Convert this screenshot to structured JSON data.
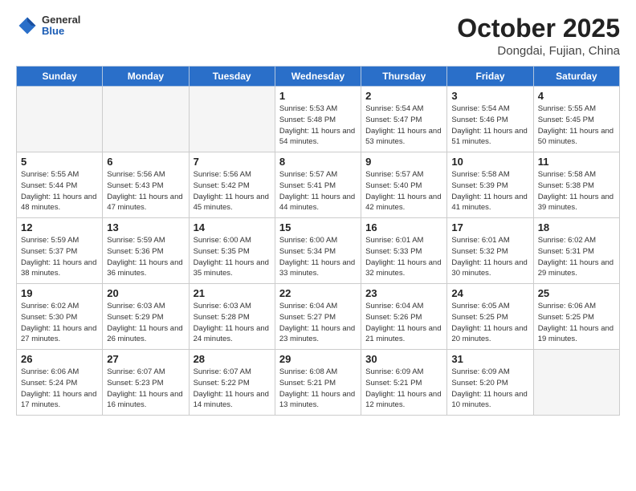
{
  "header": {
    "logo_general": "General",
    "logo_blue": "Blue",
    "month": "October 2025",
    "location": "Dongdai, Fujian, China"
  },
  "weekdays": [
    "Sunday",
    "Monday",
    "Tuesday",
    "Wednesday",
    "Thursday",
    "Friday",
    "Saturday"
  ],
  "weeks": [
    [
      {
        "day": "",
        "info": ""
      },
      {
        "day": "",
        "info": ""
      },
      {
        "day": "",
        "info": ""
      },
      {
        "day": "1",
        "info": "Sunrise: 5:53 AM\nSunset: 5:48 PM\nDaylight: 11 hours\nand 54 minutes."
      },
      {
        "day": "2",
        "info": "Sunrise: 5:54 AM\nSunset: 5:47 PM\nDaylight: 11 hours\nand 53 minutes."
      },
      {
        "day": "3",
        "info": "Sunrise: 5:54 AM\nSunset: 5:46 PM\nDaylight: 11 hours\nand 51 minutes."
      },
      {
        "day": "4",
        "info": "Sunrise: 5:55 AM\nSunset: 5:45 PM\nDaylight: 11 hours\nand 50 minutes."
      }
    ],
    [
      {
        "day": "5",
        "info": "Sunrise: 5:55 AM\nSunset: 5:44 PM\nDaylight: 11 hours\nand 48 minutes."
      },
      {
        "day": "6",
        "info": "Sunrise: 5:56 AM\nSunset: 5:43 PM\nDaylight: 11 hours\nand 47 minutes."
      },
      {
        "day": "7",
        "info": "Sunrise: 5:56 AM\nSunset: 5:42 PM\nDaylight: 11 hours\nand 45 minutes."
      },
      {
        "day": "8",
        "info": "Sunrise: 5:57 AM\nSunset: 5:41 PM\nDaylight: 11 hours\nand 44 minutes."
      },
      {
        "day": "9",
        "info": "Sunrise: 5:57 AM\nSunset: 5:40 PM\nDaylight: 11 hours\nand 42 minutes."
      },
      {
        "day": "10",
        "info": "Sunrise: 5:58 AM\nSunset: 5:39 PM\nDaylight: 11 hours\nand 41 minutes."
      },
      {
        "day": "11",
        "info": "Sunrise: 5:58 AM\nSunset: 5:38 PM\nDaylight: 11 hours\nand 39 minutes."
      }
    ],
    [
      {
        "day": "12",
        "info": "Sunrise: 5:59 AM\nSunset: 5:37 PM\nDaylight: 11 hours\nand 38 minutes."
      },
      {
        "day": "13",
        "info": "Sunrise: 5:59 AM\nSunset: 5:36 PM\nDaylight: 11 hours\nand 36 minutes."
      },
      {
        "day": "14",
        "info": "Sunrise: 6:00 AM\nSunset: 5:35 PM\nDaylight: 11 hours\nand 35 minutes."
      },
      {
        "day": "15",
        "info": "Sunrise: 6:00 AM\nSunset: 5:34 PM\nDaylight: 11 hours\nand 33 minutes."
      },
      {
        "day": "16",
        "info": "Sunrise: 6:01 AM\nSunset: 5:33 PM\nDaylight: 11 hours\nand 32 minutes."
      },
      {
        "day": "17",
        "info": "Sunrise: 6:01 AM\nSunset: 5:32 PM\nDaylight: 11 hours\nand 30 minutes."
      },
      {
        "day": "18",
        "info": "Sunrise: 6:02 AM\nSunset: 5:31 PM\nDaylight: 11 hours\nand 29 minutes."
      }
    ],
    [
      {
        "day": "19",
        "info": "Sunrise: 6:02 AM\nSunset: 5:30 PM\nDaylight: 11 hours\nand 27 minutes."
      },
      {
        "day": "20",
        "info": "Sunrise: 6:03 AM\nSunset: 5:29 PM\nDaylight: 11 hours\nand 26 minutes."
      },
      {
        "day": "21",
        "info": "Sunrise: 6:03 AM\nSunset: 5:28 PM\nDaylight: 11 hours\nand 24 minutes."
      },
      {
        "day": "22",
        "info": "Sunrise: 6:04 AM\nSunset: 5:27 PM\nDaylight: 11 hours\nand 23 minutes."
      },
      {
        "day": "23",
        "info": "Sunrise: 6:04 AM\nSunset: 5:26 PM\nDaylight: 11 hours\nand 21 minutes."
      },
      {
        "day": "24",
        "info": "Sunrise: 6:05 AM\nSunset: 5:25 PM\nDaylight: 11 hours\nand 20 minutes."
      },
      {
        "day": "25",
        "info": "Sunrise: 6:06 AM\nSunset: 5:25 PM\nDaylight: 11 hours\nand 19 minutes."
      }
    ],
    [
      {
        "day": "26",
        "info": "Sunrise: 6:06 AM\nSunset: 5:24 PM\nDaylight: 11 hours\nand 17 minutes."
      },
      {
        "day": "27",
        "info": "Sunrise: 6:07 AM\nSunset: 5:23 PM\nDaylight: 11 hours\nand 16 minutes."
      },
      {
        "day": "28",
        "info": "Sunrise: 6:07 AM\nSunset: 5:22 PM\nDaylight: 11 hours\nand 14 minutes."
      },
      {
        "day": "29",
        "info": "Sunrise: 6:08 AM\nSunset: 5:21 PM\nDaylight: 11 hours\nand 13 minutes."
      },
      {
        "day": "30",
        "info": "Sunrise: 6:09 AM\nSunset: 5:21 PM\nDaylight: 11 hours\nand 12 minutes."
      },
      {
        "day": "31",
        "info": "Sunrise: 6:09 AM\nSunset: 5:20 PM\nDaylight: 11 hours\nand 10 minutes."
      },
      {
        "day": "",
        "info": ""
      }
    ]
  ]
}
